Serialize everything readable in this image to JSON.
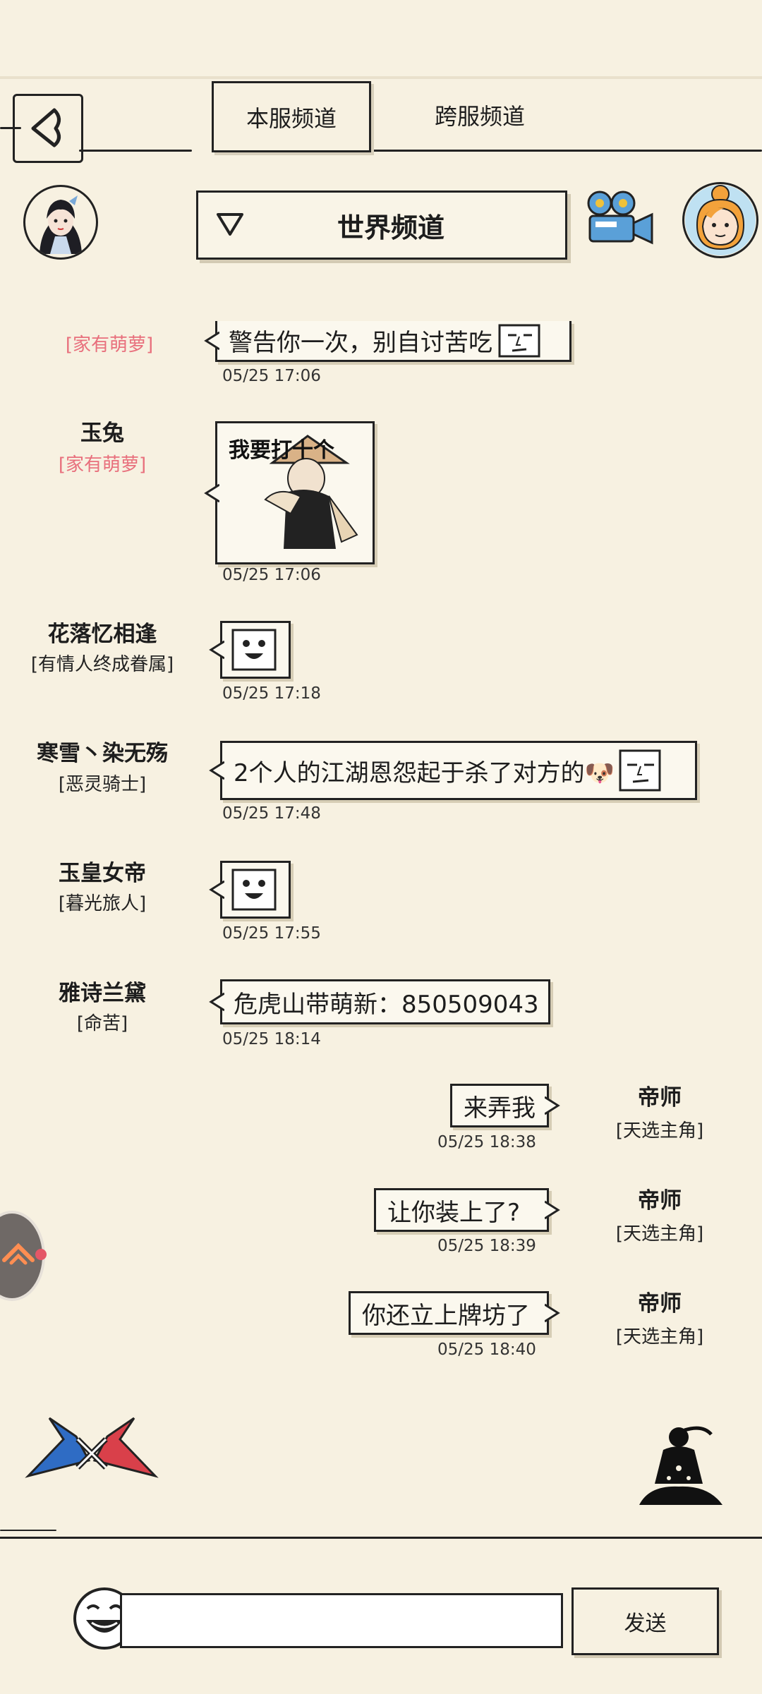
{
  "tabs": {
    "local": "本服频道",
    "cross": "跨服频道"
  },
  "channel": {
    "title": "世界频道"
  },
  "messages": [
    {
      "name": "",
      "title": "[家有萌萝]",
      "text": "警告你一次，别自讨苦吃",
      "time": "05/25 17:06"
    },
    {
      "name": "玉兔",
      "title": "[家有萌萝]",
      "text": "我要打十个",
      "time": "05/25 17:06"
    },
    {
      "name": "花落忆相逢",
      "title": "[有情人终成眷属]",
      "text": "",
      "time": "05/25 17:18"
    },
    {
      "name": "寒雪丶染无殇",
      "title": "[恶灵骑士]",
      "text": "2个人的江湖恩怨起于杀了对方的🐶",
      "time": "05/25 17:48"
    },
    {
      "name": "玉皇女帝",
      "title": "[暮光旅人]",
      "text": "",
      "time": "05/25 17:55"
    },
    {
      "name": "雅诗兰黛",
      "title": "[命苦]",
      "text": "危虎山带萌新：850509043",
      "time": "05/25 18:14"
    },
    {
      "name": "帝师",
      "title": "[天选主角]",
      "text": "来弄我",
      "time": "05/25 18:38"
    },
    {
      "name": "帝师",
      "title": "[天选主角]",
      "text": "让你装上了?",
      "time": "05/25 18:39"
    },
    {
      "name": "帝师",
      "title": "[天选主角]",
      "text": "你还立上牌坊了",
      "time": "05/25 18:40"
    }
  ],
  "composer": {
    "input_value": "",
    "send_label": "发送"
  },
  "colors": {
    "background": "#f7f1e1",
    "ink": "#222222",
    "title_pink": "#e86f7c",
    "notify_dot": "#e45767"
  }
}
